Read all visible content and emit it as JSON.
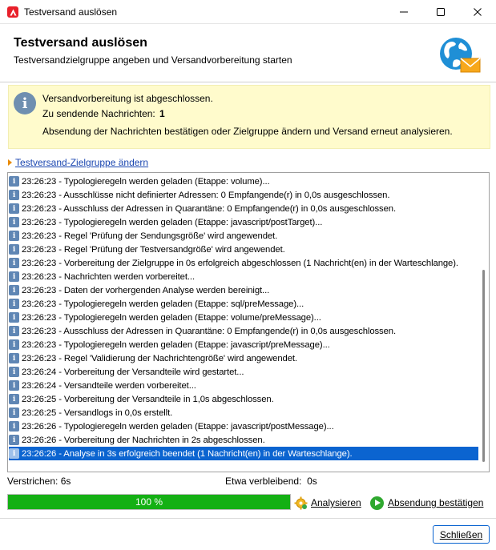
{
  "window": {
    "title": "Testversand auslösen",
    "icon": "adobe-logo-icon"
  },
  "header": {
    "title": "Testversand auslösen",
    "subtitle": "Testversandzielgruppe angeben und Versandvorbereitung starten",
    "icon": "globe-mail-icon"
  },
  "info": {
    "line1": "Versandvorbereitung ist abgeschlossen.",
    "count_label": "Zu sendende Nachrichten:",
    "count_value": "1",
    "line3": "Absendung der Nachrichten bestätigen oder Zielgruppe ändern und Versand erneut analysieren."
  },
  "change_link": "Testversand-Zielgruppe ändern",
  "log": {
    "rows": [
      "23:26:23 - Typologieregeln werden geladen (Etappe: volume)...",
      "23:26:23 - Ausschlüsse nicht definierter Adressen: 0 Empfangende(r) in 0,0s ausgeschlossen.",
      "23:26:23 - Ausschluss der Adressen in Quarantäne: 0 Empfangende(r) in 0,0s ausgeschlossen.",
      "23:26:23 - Typologieregeln werden geladen (Etappe: javascript/postTarget)...",
      "23:26:23 - Regel 'Prüfung der Sendungsgröße' wird angewendet.",
      "23:26:23 - Regel 'Prüfung der Testversandgröße' wird angewendet.",
      "23:26:23 - Vorbereitung der Zielgruppe in 0s erfolgreich abgeschlossen (1 Nachricht(en) in der Warteschlange).",
      "23:26:23 - Nachrichten werden vorbereitet...",
      "23:26:23 - Daten der vorhergenden Analyse werden bereinigt...",
      "23:26:23 - Typologieregeln werden geladen (Etappe: sql/preMessage)...",
      "23:26:23 - Typologieregeln werden geladen (Etappe: volume/preMessage)...",
      "23:26:23 - Ausschluss der Adressen in Quarantäne: 0 Empfangende(r) in 0,0s ausgeschlossen.",
      "23:26:23 - Typologieregeln werden geladen (Etappe: javascript/preMessage)...",
      "23:26:23 - Regel 'Validierung der Nachrichtengröße' wird angewendet.",
      "23:26:24 - Vorbereitung der Versandteile wird gestartet...",
      "23:26:24 - Versandteile werden vorbereitet...",
      "23:26:25 - Vorbereitung der Versandteile in 1,0s abgeschlossen.",
      "23:26:25 - Versandlogs in 0,0s erstellt.",
      "23:26:26 - Typologieregeln werden geladen (Etappe: javascript/postMessage)...",
      "23:26:26 - Vorbereitung der Nachrichten in 2s abgeschlossen.",
      "23:26:26 - Analyse in 3s erfolgreich beendet (1 Nachricht(en) in der Warteschlange)."
    ],
    "selected_index": 20,
    "row_icon": "info-icon"
  },
  "status": {
    "elapsed_label": "Verstrichen:",
    "elapsed_value": "6s",
    "remaining_label": "Etwa verbleibend:",
    "remaining_value": "0s"
  },
  "progress": {
    "percent": 100,
    "text": "100 %",
    "color": "#14b014"
  },
  "actions": {
    "analyze_label": "Analysieren",
    "confirm_label": "Absendung bestätigen"
  },
  "footer": {
    "close_label": "Schließen"
  }
}
